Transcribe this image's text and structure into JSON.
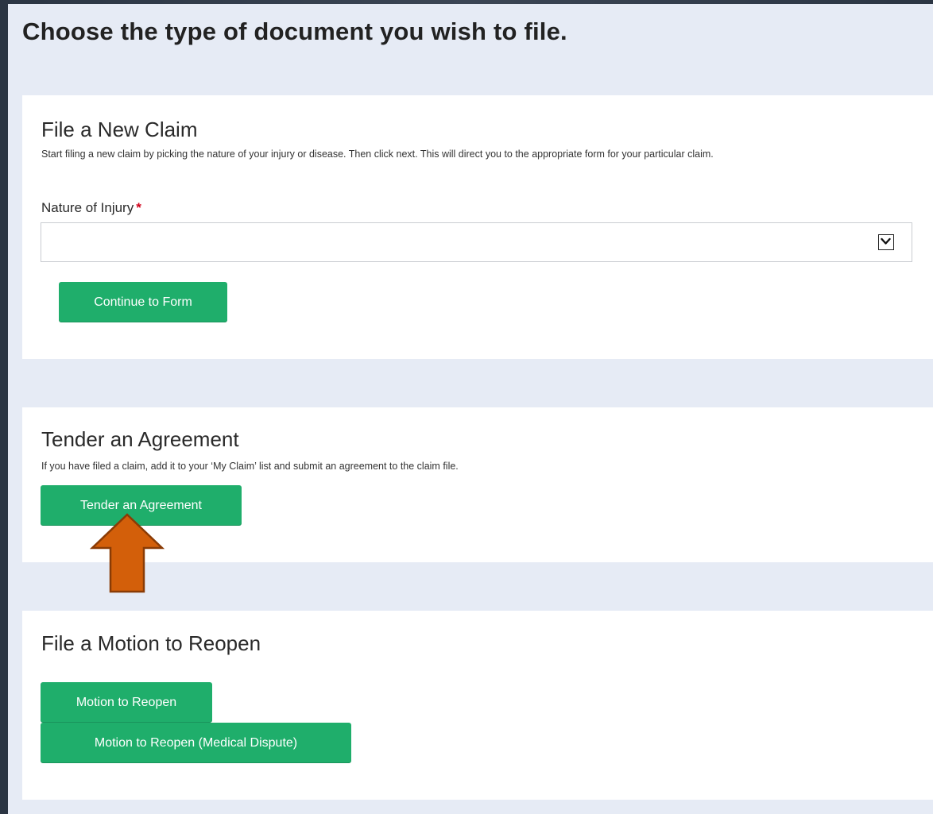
{
  "page": {
    "title": "Choose the type of document you wish to file."
  },
  "new_claim": {
    "title": "File a New Claim",
    "description": "Start filing a new claim by picking the nature of your injury or disease. Then click next. This will direct you to the appropriate form for your particular claim.",
    "field_label": "Nature of Injury",
    "required_mark": "*",
    "select_value": "",
    "continue_label": "Continue to Form"
  },
  "agreement": {
    "title": "Tender an Agreement",
    "description": "If you have filed a claim, add it to your ‘My Claim’ list and submit an agreement to the claim file.",
    "button_label": "Tender an Agreement"
  },
  "reopen": {
    "title": "File a Motion to Reopen",
    "button_label": "Motion to Reopen",
    "medical_button_label": "Motion to Reopen (Medical Dispute)"
  },
  "colors": {
    "button_green": "#1fae6b",
    "panel_bg": "#e6ebf5",
    "page_bg": "#2b3543",
    "annotation_arrow": "#d35f0a",
    "required_star": "#d0021b"
  },
  "icons": {
    "select_chevron": "chevron-down-icon",
    "annotation": "up-arrow-icon"
  }
}
